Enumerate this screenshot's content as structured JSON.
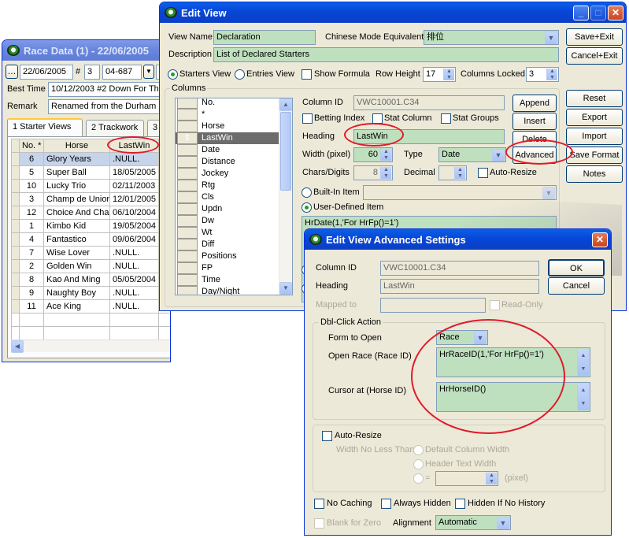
{
  "race_window": {
    "title": "Race Data (1) - 22/06/2005",
    "date": "22/06/2005",
    "hash_label": "#",
    "race_no": "3",
    "race_code": "04-687",
    "best_time_label": "Best Time",
    "best_time": "10/12/2003 #2 Down For Th",
    "remark_label": "Remark",
    "remark": "Renamed from the Durham H",
    "tabs": [
      "1 Starter Views",
      "2 Trackwork",
      "3"
    ],
    "grid": {
      "headers": [
        "No. *",
        "Horse",
        "LastWin"
      ],
      "rows": [
        [
          "6",
          "Glory Years",
          ".NULL."
        ],
        [
          "5",
          "Super Ball",
          "18/05/2005"
        ],
        [
          "10",
          "Lucky Trio",
          "02/11/2003"
        ],
        [
          "3",
          "Champ de Union",
          "12/01/2005"
        ],
        [
          "12",
          "Choice And Char",
          "06/10/2004"
        ],
        [
          "1",
          "Kimbo Kid",
          "19/05/2004"
        ],
        [
          "4",
          "Fantastico",
          "09/06/2004"
        ],
        [
          "7",
          "Wise Lover",
          ".NULL."
        ],
        [
          "2",
          "Golden Win",
          ".NULL."
        ],
        [
          "8",
          "Kao And Ming",
          "05/05/2004"
        ],
        [
          "9",
          "Naughty Boy",
          ".NULL."
        ],
        [
          "11",
          "Ace King",
          ".NULL."
        ]
      ]
    }
  },
  "edit_view": {
    "title": "Edit View",
    "view_name_label": "View Name",
    "view_name": "Declaration",
    "chinese_label": "Chinese Mode Equivalent",
    "chinese_value": "排位",
    "description_label": "Description",
    "description": "List of Declared Starters",
    "starters_view": "Starters View",
    "entries_view": "Entries View",
    "show_formula": "Show Formula",
    "row_height_label": "Row Height",
    "row_height": "17",
    "columns_locked_label": "Columns Locked",
    "columns_locked": "3",
    "columns_group": "Columns",
    "columns": [
      "No.",
      "*",
      "Horse",
      "LastWin",
      "Date",
      "Distance",
      "Jockey",
      "Rtg",
      "Cls",
      "Updn",
      "Dw",
      "Wt",
      "Diff",
      "Positions",
      "FP",
      "Time",
      "Day/Night"
    ],
    "column_id_label": "Column ID",
    "column_id": "VWC10001.C34",
    "betting_index": "Betting Index",
    "stat_column": "Stat Column",
    "stat_groups": "Stat Groups",
    "heading_label": "Heading",
    "heading": "LastWin",
    "width_label": "Width (pixel)",
    "width": "60",
    "type_label": "Type",
    "type": "Date",
    "chars_label": "Chars/Digits",
    "chars": "8",
    "decimal_label": "Decimal",
    "auto_resize": "Auto-Resize",
    "builtin_item": "Built-In Item",
    "user_defined_item": "User-Defined Item",
    "formula": "HrDate(1,'For HrFp()=1')",
    "buttons": {
      "save_exit": "Save+Exit",
      "cancel_exit": "Cancel+Exit",
      "reset": "Reset",
      "export": "Export",
      "import": "Import",
      "save_format": "Save Format",
      "notes": "Notes",
      "append": "Append",
      "insert": "Insert",
      "delete": "Delete",
      "advanced": "Advanced"
    }
  },
  "advanced": {
    "title": "Edit View Advanced Settings",
    "column_id_label": "Column ID",
    "column_id": "VWC10001.C34",
    "heading_label": "Heading",
    "heading": "LastWin",
    "mapped_to_label": "Mapped to",
    "read_only": "Read-Only",
    "ok": "OK",
    "cancel": "Cancel",
    "dblclick_group": "Dbl-Click Action",
    "form_to_open_label": "Form to Open",
    "form_to_open": "Race",
    "open_race_label": "Open Race (Race ID)",
    "open_race_value": "HrRaceID(1,'For HrFp()=1')",
    "cursor_label": "Cursor at (Horse ID)",
    "cursor_value": "HrHorseID()",
    "auto_resize": "Auto-Resize",
    "width_no_less": "Width No Less Than",
    "default_col_width": "Default Column Width",
    "header_text_width": "Header Text Width",
    "equals": "=",
    "pixel": "(pixel)",
    "no_caching": "No Caching",
    "always_hidden": "Always Hidden",
    "hidden_if_no_history": "Hidden If No History",
    "blank_for_zero": "Blank for Zero",
    "alignment_label": "Alignment",
    "alignment": "Automatic"
  },
  "colors": {
    "highlight_oval": "#e01a2a",
    "field_green": "#bfe0bf",
    "xp_title_blue": "#0846d8"
  }
}
